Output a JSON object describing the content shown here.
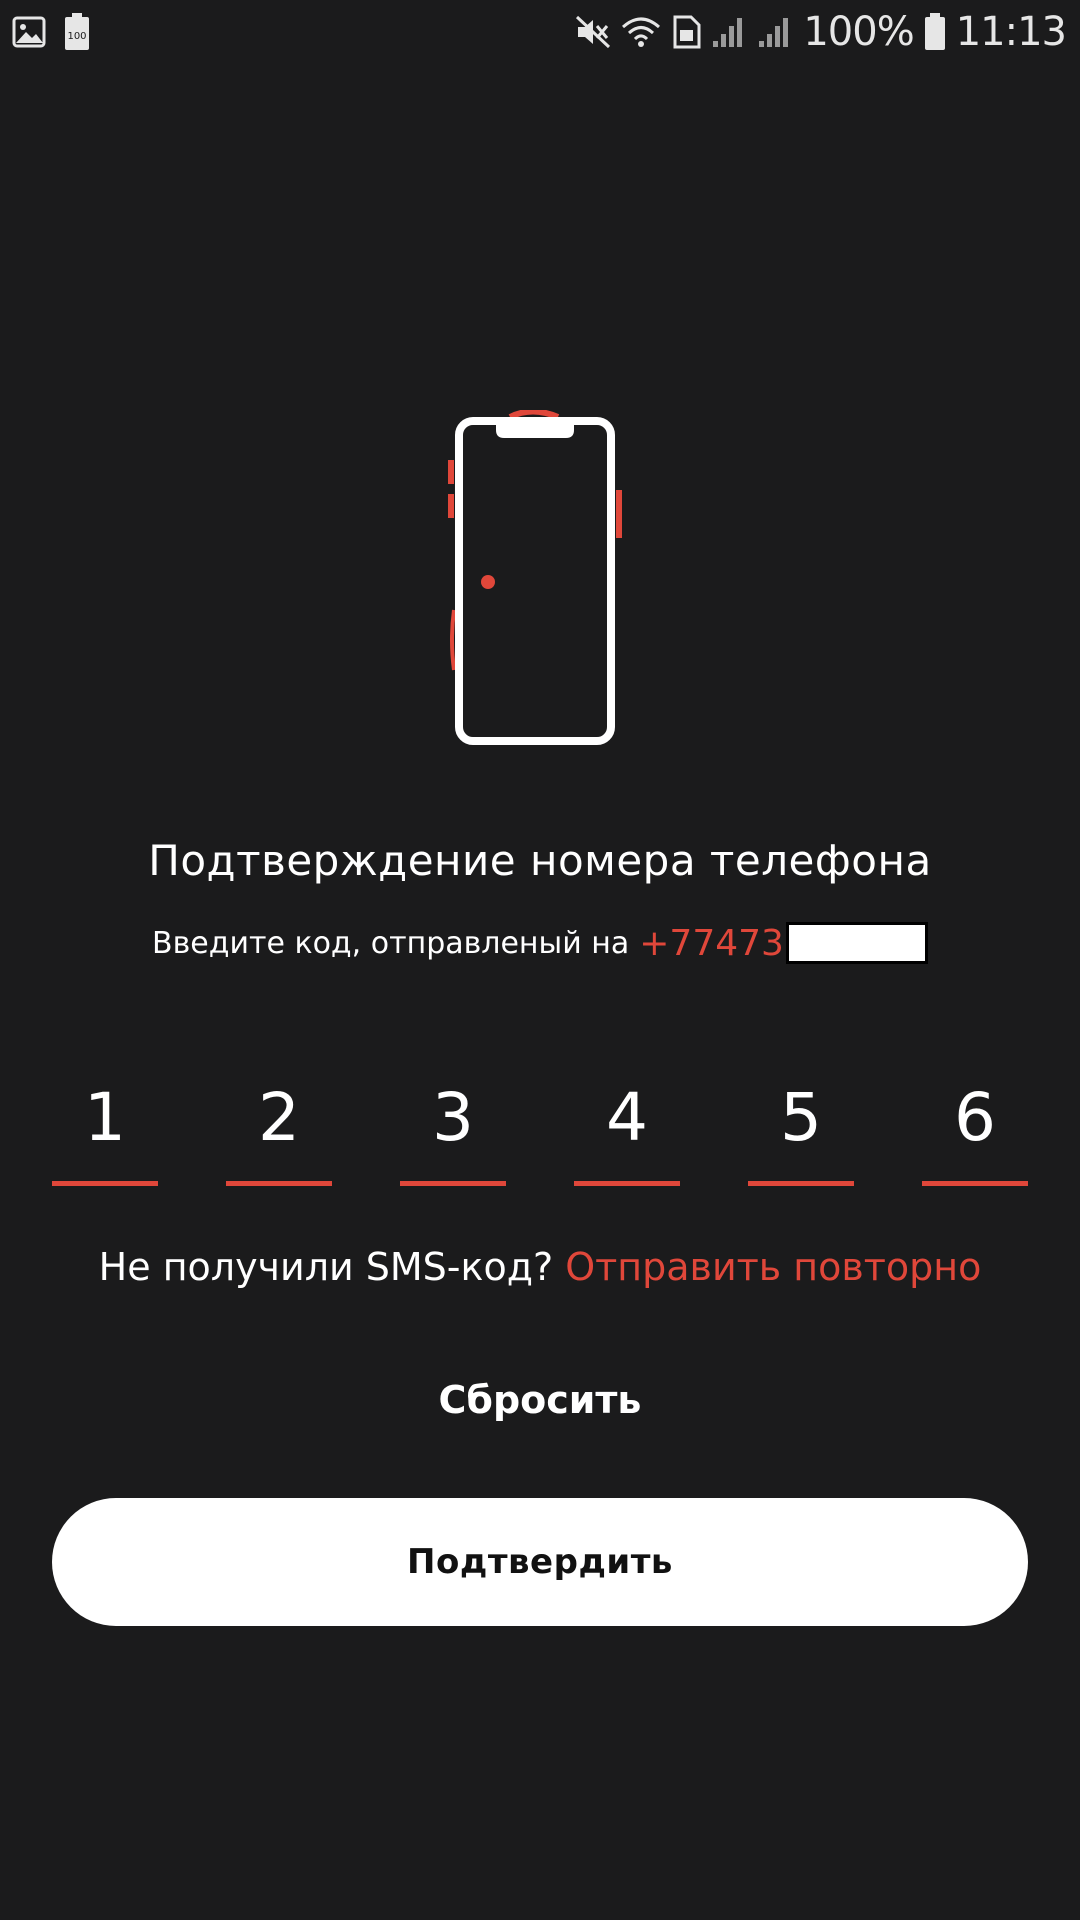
{
  "status_bar": {
    "left_icons": [
      "image-icon",
      "battery-saver-icon"
    ],
    "battery_saver_label": "100",
    "right_icons": [
      "mute-icon",
      "wifi-icon",
      "sim-icon",
      "signal-icon",
      "signal-icon"
    ],
    "battery_percent": "100%",
    "time": "11:13"
  },
  "illustration": {
    "icon": "smartphone-icon",
    "accent_color": "#e0473a"
  },
  "title": "Подтверждение номера телефона",
  "subtitle": {
    "prefix": "Введите код, отправленый на",
    "phone": "+77473"
  },
  "otp": {
    "digits": [
      "1",
      "2",
      "3",
      "4",
      "5",
      "6"
    ],
    "underline_color": "#e0473a"
  },
  "resend": {
    "question": "Не получили SMS-код?",
    "link": "Отправить повторно"
  },
  "reset_label": "Сбросить",
  "confirm_label": "Подтвердить",
  "colors": {
    "background": "#1b1b1c",
    "accent": "#e0473a",
    "button_bg": "#ffffff"
  }
}
